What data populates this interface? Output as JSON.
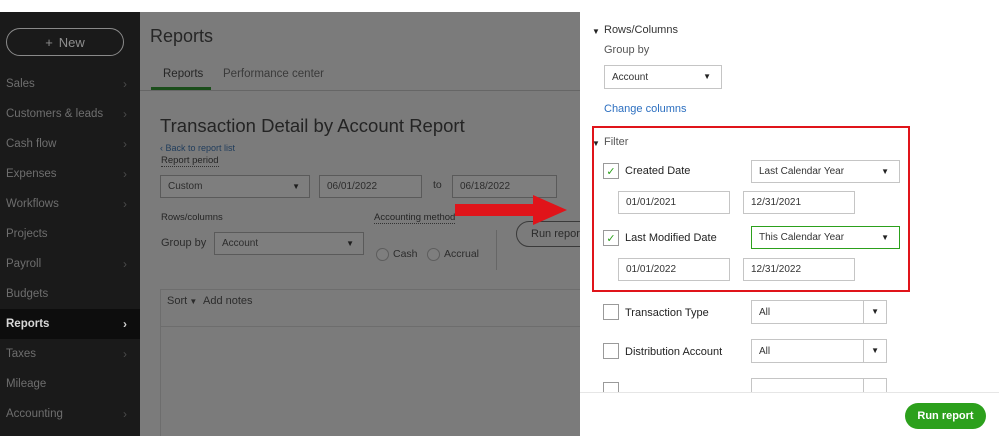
{
  "sidebar": {
    "new_label": "New",
    "items": [
      {
        "label": "Sales"
      },
      {
        "label": "Customers & leads"
      },
      {
        "label": "Cash flow"
      },
      {
        "label": "Expenses"
      },
      {
        "label": "Workflows"
      },
      {
        "label": "Projects"
      },
      {
        "label": "Payroll"
      },
      {
        "label": "Budgets"
      },
      {
        "label": "Reports",
        "active": true
      },
      {
        "label": "Taxes"
      },
      {
        "label": "Mileage"
      },
      {
        "label": "Accounting"
      }
    ]
  },
  "main": {
    "title": "Reports",
    "tabs": [
      "Reports",
      "Performance center"
    ],
    "report_title": "Transaction Detail by Account Report",
    "back_link": "Back to report list",
    "report_period_label": "Report period",
    "period_value": "Custom",
    "from_date": "06/01/2022",
    "to_label": "to",
    "to_date": "06/18/2022",
    "rows_columns_label": "Rows/columns",
    "group_by_label": "Group by",
    "group_by_value": "Account",
    "accounting_method_label": "Accounting method",
    "cash_label": "Cash",
    "accrual_label": "Accrual",
    "run_report_label": "Run repor",
    "sort_label": "Sort",
    "add_notes_label": "Add notes"
  },
  "panel": {
    "rows_columns_title": "Rows/Columns",
    "group_by_label": "Group by",
    "group_by_value": "Account",
    "change_columns_link": "Change columns",
    "filter_title": "Filter",
    "created_date": {
      "label": "Created Date",
      "range": "Last Calendar Year",
      "from": "01/01/2021",
      "to": "12/31/2021",
      "checked": true
    },
    "last_modified_date": {
      "label": "Last Modified Date",
      "range": "This Calendar Year",
      "from": "01/01/2022",
      "to": "12/31/2022",
      "checked": true
    },
    "transaction_type": {
      "label": "Transaction Type",
      "value": "All",
      "checked": false
    },
    "distribution_account": {
      "label": "Distribution Account",
      "value": "All",
      "checked": false
    },
    "run_report_label": "Run report"
  },
  "colors": {
    "accent_green": "#2ca01c",
    "highlight_red": "#e0141a",
    "link_blue": "#2c6fc0"
  }
}
